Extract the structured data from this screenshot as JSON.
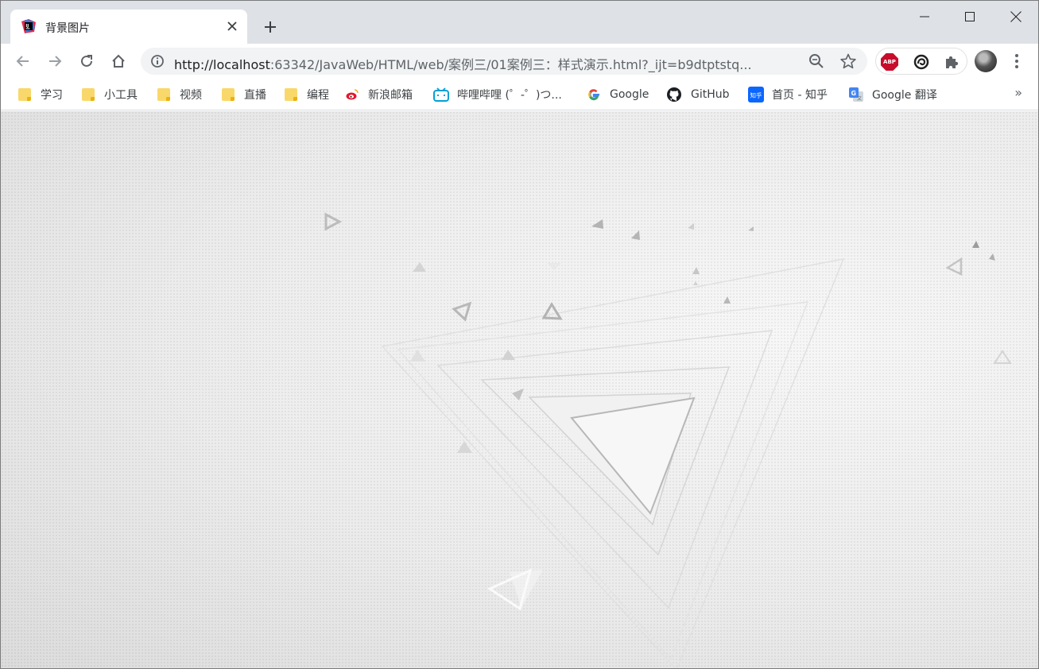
{
  "tab": {
    "title": "背景图片",
    "favicon": "jetbrains-icon",
    "close": "close-icon"
  },
  "window": {
    "minimize": "minimize-icon",
    "maximize": "maximize-icon",
    "close": "close-icon"
  },
  "toolbar": {
    "url_host": "http://localhost",
    "url_rest": ":63342/JavaWeb/HTML/web/案例三/01案例三：样式演示.html?_ijt=b9dtptstq...",
    "back": "back-arrow-icon",
    "forward": "forward-arrow-icon",
    "reload": "reload-icon",
    "home": "home-icon",
    "zoom": "zoom-icon",
    "star": "star-icon",
    "menu": "more-vert-icon"
  },
  "extensions": {
    "abp_label": "ABP",
    "abp": "adblock-plus-icon",
    "ext2": "circle-ext-icon",
    "puzzle": "puzzle-icon"
  },
  "bookmarks": [
    {
      "label": "学习",
      "icon": "folder-icon"
    },
    {
      "label": "小工具",
      "icon": "folder-icon"
    },
    {
      "label": "视频",
      "icon": "folder-icon"
    },
    {
      "label": "直播",
      "icon": "folder-icon"
    },
    {
      "label": "编程",
      "icon": "folder-icon"
    },
    {
      "label": "新浪邮箱",
      "icon": "weibo-icon"
    },
    {
      "label": "哔哩哔哩 (゜-゜)つ...",
      "icon": "bilibili-icon"
    },
    {
      "label": "Google",
      "icon": "google-icon"
    },
    {
      "label": "GitHub",
      "icon": "github-icon"
    },
    {
      "label": "首页 - 知乎",
      "icon": "zhihu-icon"
    },
    {
      "label": "Google 翻译",
      "icon": "google-translate-icon"
    }
  ],
  "bookmarks_more": "»",
  "colors": {
    "tabstrip": "#dee1e6",
    "omnibox": "#f1f3f4",
    "abp_red": "#c70d2c",
    "folder": "#f9d86b"
  }
}
